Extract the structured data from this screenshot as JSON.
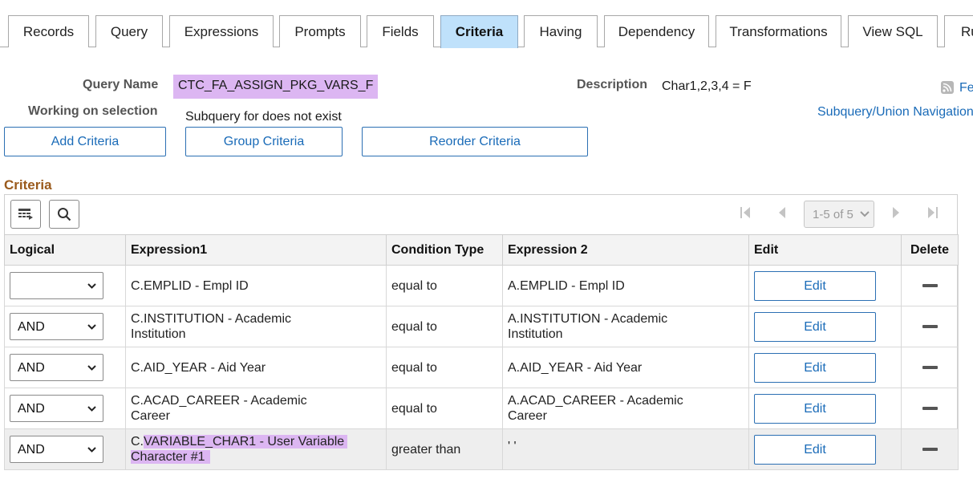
{
  "tabs": [
    {
      "label": "Records",
      "active": false
    },
    {
      "label": "Query",
      "active": false
    },
    {
      "label": "Expressions",
      "active": false
    },
    {
      "label": "Prompts",
      "active": false
    },
    {
      "label": "Fields",
      "active": false
    },
    {
      "label": "Criteria",
      "active": true
    },
    {
      "label": "Having",
      "active": false
    },
    {
      "label": "Dependency",
      "active": false
    },
    {
      "label": "Transformations",
      "active": false
    },
    {
      "label": "View SQL",
      "active": false
    },
    {
      "label": "Ru",
      "active": false
    }
  ],
  "header": {
    "query_name_label": "Query Name",
    "query_name_value": "CTC_FA_ASSIGN_PKG_VARS_F",
    "description_label": "Description",
    "description_value": "Char1,2,3,4 = F",
    "feed_label": "Fe",
    "working_label": "Working on selection",
    "subquery_text": "Subquery for does not exist",
    "subquery_nav_link": "Subquery/Union Navigation"
  },
  "actions": {
    "add_criteria": "Add Criteria",
    "group_criteria": "Group Criteria",
    "reorder_criteria": "Reorder Criteria"
  },
  "criteria": {
    "title": "Criteria",
    "pager_text": "1-5 of 5",
    "columns": {
      "logical": "Logical",
      "expression1": "Expression1",
      "condition_type": "Condition Type",
      "expression2": "Expression 2",
      "edit": "Edit",
      "delete": "Delete"
    },
    "rows": [
      {
        "logical": "",
        "expr1": "C.EMPLID - Empl ID",
        "condition": "equal to",
        "expr2": "A.EMPLID - Empl ID",
        "edit": "Edit"
      },
      {
        "logical": "AND",
        "expr1": "C.INSTITUTION - Academic Institution",
        "condition": "equal to",
        "expr2": "A.INSTITUTION - Academic Institution",
        "edit": "Edit"
      },
      {
        "logical": "AND",
        "expr1": "C.AID_YEAR - Aid Year",
        "condition": "equal to",
        "expr2": "A.AID_YEAR - Aid Year",
        "edit": "Edit"
      },
      {
        "logical": "AND",
        "expr1": "C.ACAD_CAREER - Academic Career",
        "condition": "equal to",
        "expr2": "A.ACAD_CAREER - Academic Career",
        "edit": "Edit"
      },
      {
        "logical": "AND",
        "expr1_prefix": "C.",
        "expr1_hl_line1": "VARIABLE_CHAR1 - User Variable",
        "expr1_hl_line2": "Character #1",
        "condition": "greater than",
        "expr2": "' '",
        "edit": "Edit"
      }
    ]
  },
  "colors": {
    "active_tab": "#bfe1fb",
    "highlight": "#dcb6f2",
    "link": "#1a6bb8",
    "section_title": "#9a5a1c"
  }
}
